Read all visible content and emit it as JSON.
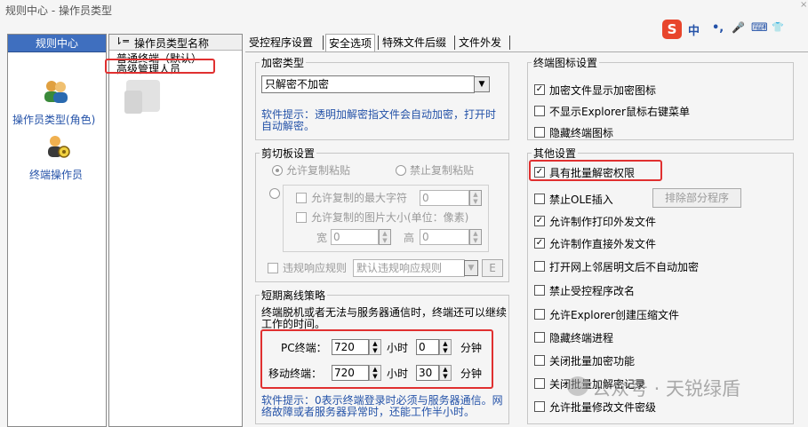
{
  "window": {
    "title": "规则中心 - 操作员类型",
    "close": "×"
  },
  "leftnav": {
    "header": "规则中心",
    "items": [
      {
        "label": "操作员类型(角色)",
        "icon": "users-icon"
      },
      {
        "label": "终端操作员",
        "icon": "user-gear-icon"
      }
    ]
  },
  "list": {
    "header": "操作员类型名称",
    "rows": [
      "普通终端（默认）",
      "高级管理人员"
    ]
  },
  "tabs": [
    "受控程序设置",
    "安全选项",
    "特殊文件后缀",
    "文件外发"
  ],
  "encryption": {
    "title": "加密类型",
    "selected": "只解密不加密",
    "hint": "软件提示：透明加解密指文件会自动加密，打开时自动解密。"
  },
  "clipboard": {
    "title": "剪切板设置",
    "allow_copy": "允许复制粘贴",
    "forbid_copy": "禁止复制粘贴",
    "max_chars_label": "允许复制的最大字符",
    "max_chars_value": "0",
    "max_image_label": "允许复制的图片大小(单位：像素)",
    "width_label": "宽",
    "width_value": "0",
    "height_label": "高",
    "height_value": "0",
    "violation_label": "违规响应规则",
    "violation_selected": "默认违规响应规则",
    "violation_btn": "E"
  },
  "offline": {
    "title": "短期离线策略",
    "desc": "终端脱机或者无法与服务器通信时，终端还可以继续工作的时间。",
    "pc_label": "PC终端：",
    "pc_hours": "720",
    "pc_minutes": "0",
    "mobile_label": "移动终端：",
    "mobile_hours": "720",
    "mobile_minutes": "30",
    "hours_unit": "小时",
    "minutes_unit": "分钟",
    "hint": "软件提示：0表示终端登录时必须与服务器通信。网络故障或者服务器异常时，还能工作半小时。"
  },
  "icon_settings": {
    "title": "终端图标设置",
    "items": [
      {
        "label": "加密文件显示加密图标",
        "checked": true
      },
      {
        "label": "不显示Explorer鼠标右键菜单",
        "checked": false
      },
      {
        "label": "隐藏终端图标",
        "checked": false
      }
    ]
  },
  "other": {
    "title": "其他设置",
    "items": [
      {
        "label": "具有批量解密权限",
        "checked": true
      },
      {
        "label": "禁止OLE插入",
        "checked": false
      },
      {
        "label": "允许制作打印外发文件",
        "checked": true
      },
      {
        "label": "允许制作直接外发文件",
        "checked": true
      },
      {
        "label": "打开网上邻居明文后不自动加密",
        "checked": false
      },
      {
        "label": "禁止受控程序改名",
        "checked": false
      },
      {
        "label": "允许Explorer创建压缩文件",
        "checked": false
      },
      {
        "label": "隐藏终端进程",
        "checked": false
      },
      {
        "label": "关闭批量加密功能",
        "checked": false
      },
      {
        "label": "关闭批量加解密记录",
        "checked": false
      },
      {
        "label": "允许批量修改文件密级",
        "checked": false
      }
    ],
    "exclude_btn": "排除部分程序"
  },
  "ime": {
    "logo": "S",
    "items": [
      "中",
      "•,",
      "🎤",
      "⌨",
      "👕"
    ]
  },
  "watermark": "公众号 · 天锐绿盾",
  "colors": {
    "accent": "#3f6fbf",
    "hint": "#2452a8",
    "highlight": "#e03030"
  }
}
